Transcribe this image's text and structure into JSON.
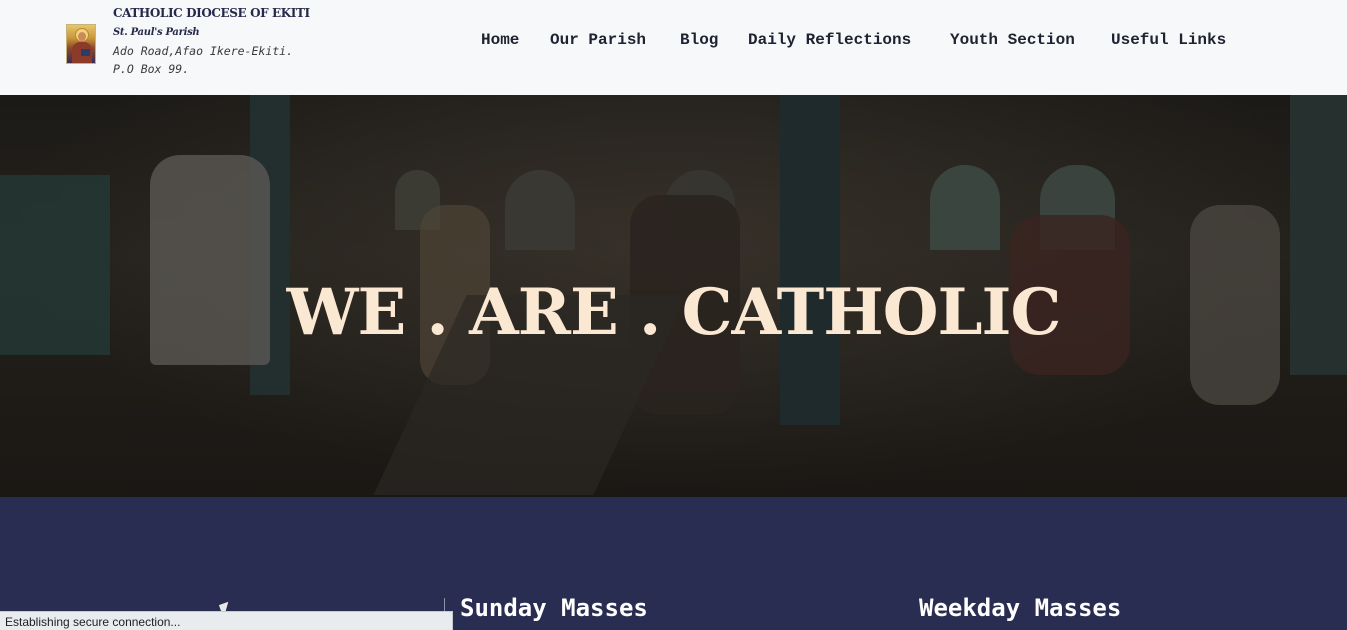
{
  "header": {
    "diocese": "CATHOLIC DIOCESE OF EKITI",
    "parish": "St. Paul's Parish",
    "address_line1": "Ado Road,Afao Ikere-Ekiti.",
    "address_line2": "P.O Box 99.",
    "logo_icon": "saint-paul-icon"
  },
  "nav": {
    "items": [
      {
        "label": "Home"
      },
      {
        "label": "Our Parish"
      },
      {
        "label": "Blog"
      },
      {
        "label": "Daily Reflections"
      },
      {
        "label": "Youth Section"
      },
      {
        "label": "Useful Links"
      }
    ]
  },
  "hero": {
    "title": "WE . ARE . CATHOLIC"
  },
  "masses": {
    "sunday_heading": "Sunday Masses",
    "weekday_heading": "Weekday Masses"
  },
  "status_bar": {
    "text": "Establishing secure connection..."
  },
  "colors": {
    "header_bg": "#f7f8fa",
    "band_bg": "#292d51",
    "hero_text": "#fbe8d3"
  }
}
